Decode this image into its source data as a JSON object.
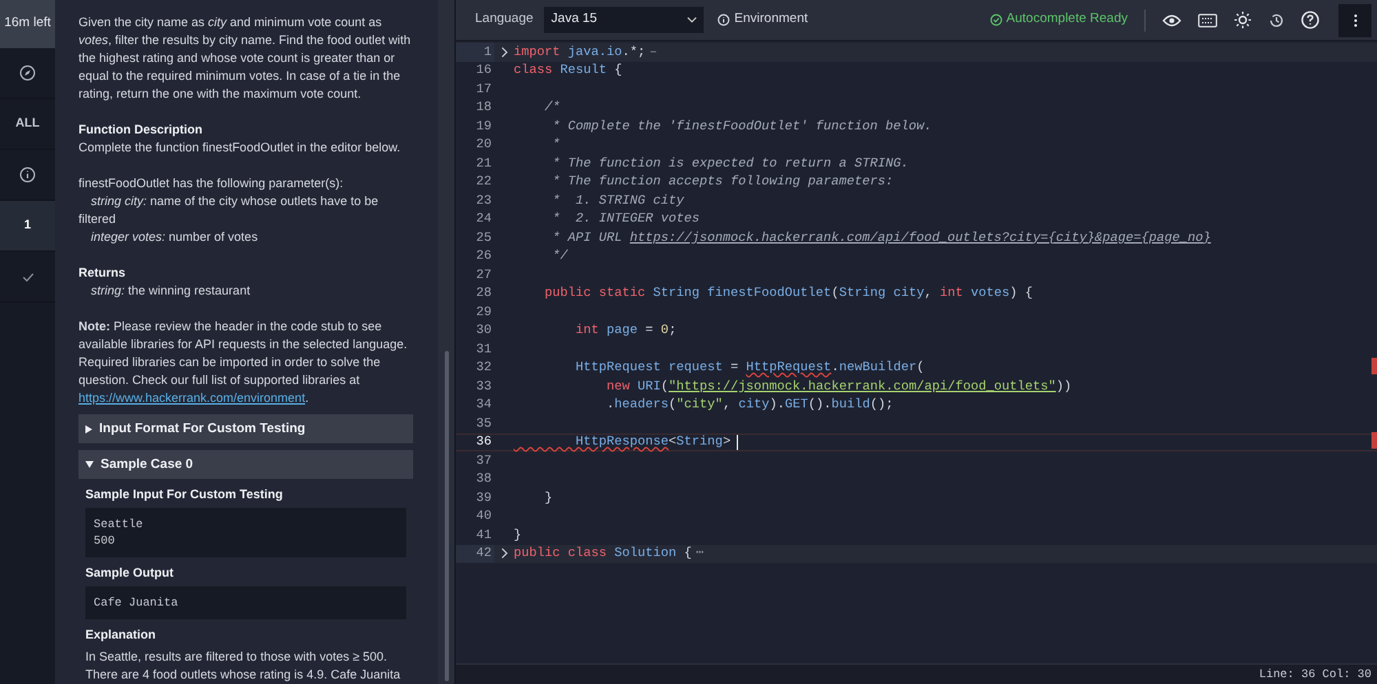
{
  "sidebar": {
    "timer": "16m left",
    "items": [
      {
        "kind": "icon",
        "selected": false
      },
      {
        "kind": "text",
        "label": "ALL",
        "selected": false
      },
      {
        "kind": "icon",
        "selected": false
      },
      {
        "kind": "text",
        "label": "1",
        "selected": true
      },
      {
        "kind": "icon",
        "selected": false
      }
    ]
  },
  "problem": {
    "intro": "Given the city name as *city* and minimum vote count as *votes*, filter the results by city name. Find the food outlet with the highest rating and whose vote count is greater than or equal to the required minimum votes. In case of a tie in the rating, return the one with the maximum vote count.",
    "function_heading": "Function Description",
    "function_text": "Complete the function finestFoodOutlet in the editor below.",
    "params_text": "finestFoodOutlet has the following parameter(s):",
    "params": [
      "*string city:* name of the city whose outlets have to be filtered",
      "*integer votes:* number of votes"
    ],
    "returns_heading": "Returns",
    "returns": [
      "*string:* the winning restaurant"
    ],
    "note": "**Note:** Please review the header in the code stub to see available libraries for API requests in the selected language. Required libraries can be imported in order to solve the question. Check our full list of supported libraries at",
    "note_link": "https://www.hackerrank.com/environment",
    "note_end": ".",
    "sections": [
      {
        "title": "Input Format For Custom Testing",
        "expanded": false
      },
      {
        "title": "Sample Case 0",
        "expanded": true,
        "blocks": [
          {
            "kind": "code",
            "heading": "Sample Input For Custom Testing",
            "lines": [
              "Seattle",
              "500"
            ]
          },
          {
            "kind": "code",
            "heading": "Sample Output",
            "lines": [
              "Cafe Juanita"
            ]
          },
          {
            "kind": "text",
            "heading": "Explanation",
            "text": "In Seattle, results are filtered to those with votes ≥ 500. There are 4 food outlets whose rating is 4.9. Cafe Juanita"
          }
        ]
      }
    ]
  },
  "toolbar": {
    "language_label": "Language",
    "language": "Java 15",
    "environment": "Environment",
    "autocomplete": "Autocomplete Ready"
  },
  "editor": {
    "lines": [
      {
        "number": "1",
        "folded": true,
        "current": false,
        "tokens": [
          {
            "kind": "kw",
            "text": "import "
          },
          {
            "kind": "type",
            "text": "java.io"
          },
          {
            "kind": "plain",
            "text": ".*;"
          },
          {
            "kind": "fold",
            "text": "–"
          }
        ]
      },
      {
        "number": "16",
        "folded": false,
        "current": false,
        "tokens": [
          {
            "kind": "kw",
            "text": "class "
          },
          {
            "kind": "type",
            "text": "Result"
          },
          {
            "kind": "plain",
            "text": " {"
          }
        ]
      },
      {
        "number": "17",
        "folded": false,
        "current": false
      },
      {
        "number": "18",
        "folded": false,
        "current": false,
        "tokens": [
          {
            "kind": "comment",
            "text": "    /*"
          }
        ]
      },
      {
        "number": "19",
        "folded": false,
        "current": false,
        "tokens": [
          {
            "kind": "comment",
            "text": "     * Complete the 'finestFoodOutlet' function below."
          }
        ]
      },
      {
        "number": "20",
        "folded": false,
        "current": false,
        "tokens": [
          {
            "kind": "comment",
            "text": "     *"
          }
        ]
      },
      {
        "number": "21",
        "folded": false,
        "current": false,
        "tokens": [
          {
            "kind": "comment",
            "text": "     * The function is expected to return a STRING."
          }
        ]
      },
      {
        "number": "22",
        "folded": false,
        "current": false,
        "tokens": [
          {
            "kind": "comment",
            "text": "     * The function accepts following parameters:"
          }
        ]
      },
      {
        "number": "23",
        "folded": false,
        "current": false,
        "tokens": [
          {
            "kind": "comment",
            "text": "     *  1. STRING city"
          }
        ]
      },
      {
        "number": "24",
        "folded": false,
        "current": false,
        "tokens": [
          {
            "kind": "comment",
            "text": "     *  2. INTEGER votes"
          }
        ]
      },
      {
        "number": "25",
        "folded": false,
        "current": false,
        "tokens": [
          {
            "kind": "comment",
            "text": "     * API URL "
          },
          {
            "kind": "comment_link",
            "text": "https://jsonmock.hackerrank.com/api/food_outlets?city={city}&page={page_no}"
          }
        ]
      },
      {
        "number": "26",
        "folded": false,
        "current": false,
        "tokens": [
          {
            "kind": "comment",
            "text": "     */"
          }
        ]
      },
      {
        "number": "27",
        "folded": false,
        "current": false
      },
      {
        "number": "28",
        "folded": false,
        "current": false,
        "tokens": [
          {
            "kind": "kw",
            "text": "    public static "
          },
          {
            "kind": "type",
            "text": "String finestFoodOutlet"
          },
          {
            "kind": "plain",
            "text": "("
          },
          {
            "kind": "type",
            "text": "String city"
          },
          {
            "kind": "plain",
            "text": ", "
          },
          {
            "kind": "kw",
            "text": "int "
          },
          {
            "kind": "type",
            "text": "votes"
          },
          {
            "kind": "plain",
            "text": ") {"
          }
        ]
      },
      {
        "number": "29",
        "folded": false,
        "current": false
      },
      {
        "number": "30",
        "folded": false,
        "current": false,
        "tokens": [
          {
            "kind": "kw",
            "text": "        int "
          },
          {
            "kind": "type",
            "text": "page"
          },
          {
            "kind": "plain",
            "text": " = "
          },
          {
            "kind": "num",
            "text": "0"
          },
          {
            "kind": "plain",
            "text": ";"
          }
        ]
      },
      {
        "number": "31",
        "folded": false,
        "current": false
      },
      {
        "number": "32",
        "folded": false,
        "current": false,
        "tokens": [
          {
            "kind": "type",
            "text": "        HttpRequest request"
          },
          {
            "kind": "plain",
            "text": " = "
          },
          {
            "kind": "type_error",
            "text": "HttpRequest"
          },
          {
            "kind": "plain",
            "text": "."
          },
          {
            "kind": "type",
            "text": "newBuilder"
          },
          {
            "kind": "plain",
            "text": "("
          }
        ]
      },
      {
        "number": "33",
        "folded": false,
        "current": false,
        "tokens": [
          {
            "kind": "kw",
            "text": "            new "
          },
          {
            "kind": "type",
            "text": "URI"
          },
          {
            "kind": "plain",
            "text": "("
          },
          {
            "kind": "string_link",
            "text": "\"https://jsonmock.hackerrank.com/api/food_outlets\""
          },
          {
            "kind": "plain",
            "text": "))"
          }
        ]
      },
      {
        "number": "34",
        "folded": false,
        "current": false,
        "tokens": [
          {
            "kind": "plain",
            "text": "            ."
          },
          {
            "kind": "type",
            "text": "headers"
          },
          {
            "kind": "plain",
            "text": "("
          },
          {
            "kind": "string",
            "text": "\"city\""
          },
          {
            "kind": "plain",
            "text": ", "
          },
          {
            "kind": "type",
            "text": "city"
          },
          {
            "kind": "plain",
            "text": ")."
          },
          {
            "kind": "type",
            "text": "GET"
          },
          {
            "kind": "plain",
            "text": "()."
          },
          {
            "kind": "type",
            "text": "build"
          },
          {
            "kind": "plain",
            "text": "();"
          }
        ]
      },
      {
        "number": "35",
        "folded": false,
        "current": false
      },
      {
        "number": "36",
        "folded": false,
        "current": true,
        "tokens": [
          {
            "kind": "type_error",
            "text": "        HttpResponse"
          },
          {
            "kind": "plain",
            "text": "<"
          },
          {
            "kind": "type",
            "text": "String"
          },
          {
            "kind": "plain",
            "text": ">"
          }
        ]
      },
      {
        "number": "37",
        "folded": false,
        "current": false
      },
      {
        "number": "38",
        "folded": false,
        "current": false
      },
      {
        "number": "39",
        "folded": false,
        "current": false,
        "tokens": [
          {
            "kind": "plain",
            "text": "    }"
          }
        ]
      },
      {
        "number": "40",
        "folded": false,
        "current": false
      },
      {
        "number": "41",
        "folded": false,
        "current": false,
        "tokens": [
          {
            "kind": "plain",
            "text": "}"
          }
        ]
      },
      {
        "number": "42",
        "folded": true,
        "current": false,
        "tokens": [
          {
            "kind": "kw",
            "text": "public class "
          },
          {
            "kind": "type",
            "text": "Solution"
          },
          {
            "kind": "plain",
            "text": " {"
          },
          {
            "kind": "fold",
            "text": "⋯"
          }
        ]
      }
    ]
  },
  "status_bar": {
    "position": "Line: 36 Col: 30"
  }
}
